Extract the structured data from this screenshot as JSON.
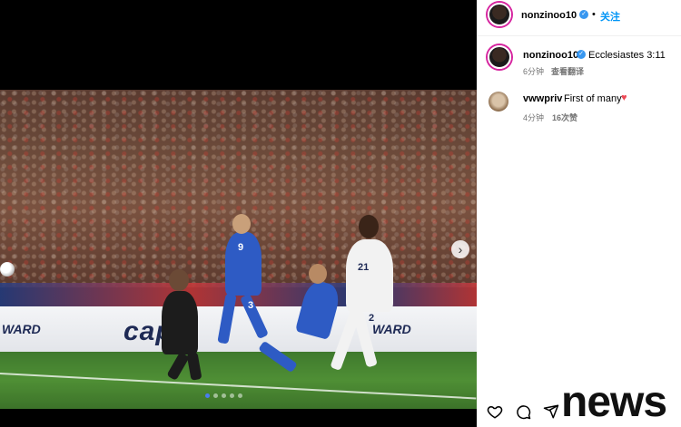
{
  "post": {
    "username": "nonzinoo10",
    "follow_label": "关注",
    "separator": "•",
    "caption": "Ecclesiastes 3:11",
    "caption_time": "6分钟",
    "translate_label": "查看翻译"
  },
  "comments": [
    {
      "username": "vwwpriv",
      "text": "First of many",
      "emoji": "♥",
      "time": "4分钟",
      "likes": "16次赞"
    }
  ],
  "photo": {
    "banner_left": "WARD",
    "banner_center": "capi",
    "banner_right": "WARD",
    "player_numbers": [
      "9",
      "3",
      "21",
      "2"
    ],
    "carousel_total": 5,
    "carousel_active": 0
  },
  "icons": {
    "like": "heart-icon",
    "comment": "comment-icon",
    "share": "send-icon",
    "next": "chevron-right-icon",
    "verified": "verified-badge-icon"
  },
  "watermark": "news",
  "colors": {
    "follow": "#0095f6",
    "verified": "#3897f0",
    "heart": "#ed4956"
  }
}
